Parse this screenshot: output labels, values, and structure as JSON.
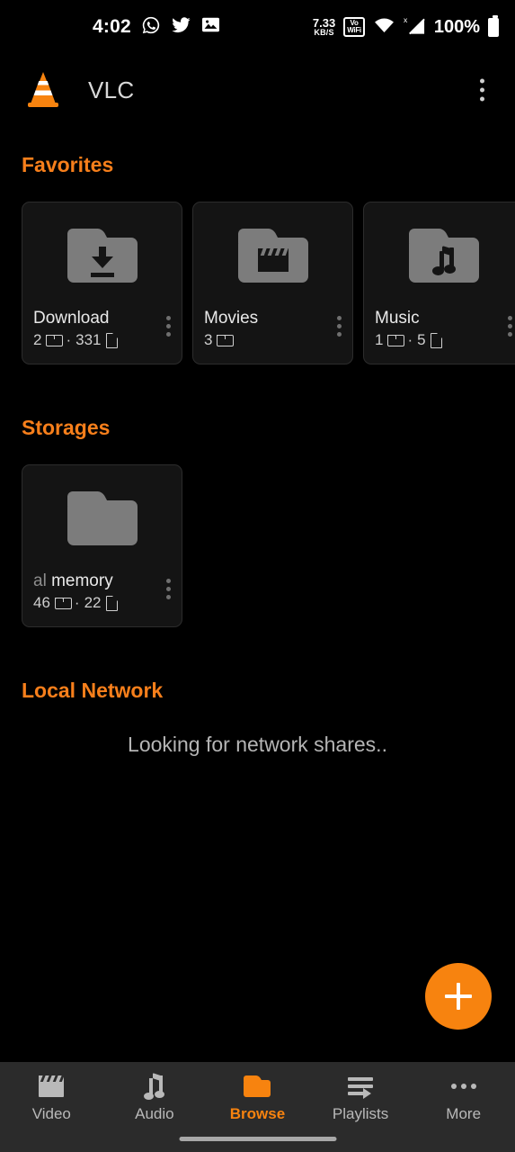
{
  "status_bar": {
    "time": "4:02",
    "notification_icons": [
      "whatsapp-icon",
      "twitter-icon",
      "image-icon"
    ],
    "network_speed_value": "7.33",
    "network_speed_unit": "KB/S",
    "vowifi_line1": "Vo",
    "vowifi_line2": "WiFi",
    "wifi_icon": "wifi-icon",
    "signal_icon": "signal-no-service-icon",
    "battery_percent": "100%"
  },
  "app_bar": {
    "title": "VLC",
    "logo": "vlc-cone-logo",
    "overflow": "overflow-menu-icon"
  },
  "sections": {
    "favorites": {
      "title": "Favorites",
      "cards": [
        {
          "name": "Download",
          "folders": "2",
          "files": "331",
          "icon": "folder-download-icon",
          "has_files": true
        },
        {
          "name": "Movies",
          "folders": "3",
          "files": "",
          "icon": "folder-movies-icon",
          "has_files": false
        },
        {
          "name": "Music",
          "folders": "1",
          "files": "5",
          "icon": "folder-music-icon",
          "has_files": true
        }
      ]
    },
    "storages": {
      "title": "Storages",
      "cards": [
        {
          "name_dim": "al",
          "name": " memory",
          "folders": "46",
          "files": "22",
          "icon": "folder-icon",
          "has_files": true
        }
      ]
    },
    "local_network": {
      "title": "Local Network",
      "message": "Looking for network shares.."
    }
  },
  "fab": {
    "label": "+",
    "icon": "add-icon",
    "color": "#f7830f"
  },
  "bottom_nav": {
    "items": [
      {
        "label": "Video",
        "icon": "video-clapper-icon",
        "active": false
      },
      {
        "label": "Audio",
        "icon": "audio-note-icon",
        "active": false
      },
      {
        "label": "Browse",
        "icon": "browse-folder-icon",
        "active": true
      },
      {
        "label": "Playlists",
        "icon": "playlists-icon",
        "active": false
      },
      {
        "label": "More",
        "icon": "more-dots-icon",
        "active": false
      }
    ]
  },
  "separator": "·",
  "colors": {
    "accent": "#f7830f",
    "background": "#000000",
    "card": "#141414",
    "nav": "#2b2b2b"
  }
}
